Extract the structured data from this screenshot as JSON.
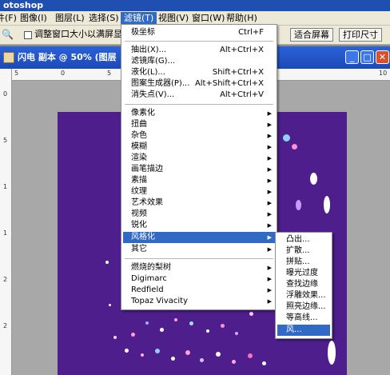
{
  "app": {
    "title": "otoshop"
  },
  "menubar": {
    "items": [
      {
        "label": "文件(F)"
      },
      {
        "label": "图像(I)"
      },
      {
        "label": "图层(L)"
      },
      {
        "label": "选择(S)"
      },
      {
        "label": "滤镜(T)"
      },
      {
        "label": "视图(V)"
      },
      {
        "label": "窗口(W)"
      },
      {
        "label": "帮助(H)"
      }
    ]
  },
  "options": {
    "resize_windows_label": "调整窗口大小以满屏显示",
    "fit_screen_label": "适合屏幕",
    "print_size_label": "打印尺寸"
  },
  "document": {
    "title": "闪电 副本 @ 50% (图层"
  },
  "ruler": {
    "top_labels": [
      "5",
      "0",
      "5",
      "10"
    ],
    "left_labels": [
      "0",
      "5",
      "1",
      "1",
      "2",
      "2"
    ]
  },
  "filter_menu": {
    "items": [
      {
        "label": "极坐标",
        "shortcut": "Ctrl+F"
      },
      {
        "label": "抽出(X)...",
        "shortcut": "Alt+Ctrl+X"
      },
      {
        "label": "滤镜库(G)...",
        "shortcut": ""
      },
      {
        "label": "液化(L)...",
        "shortcut": "Shift+Ctrl+X"
      },
      {
        "label": "图案生成器(P)...",
        "shortcut": "Alt+Shift+Ctrl+X"
      },
      {
        "label": "消失点(V)...",
        "shortcut": "Alt+Ctrl+V"
      },
      {
        "label": "像素化"
      },
      {
        "label": "扭曲"
      },
      {
        "label": "杂色"
      },
      {
        "label": "模糊"
      },
      {
        "label": "渲染"
      },
      {
        "label": "画笔描边"
      },
      {
        "label": "素描"
      },
      {
        "label": "纹理"
      },
      {
        "label": "艺术效果"
      },
      {
        "label": "视频"
      },
      {
        "label": "锐化"
      },
      {
        "label": "风格化"
      },
      {
        "label": "其它"
      },
      {
        "label": "燃烧的梨树"
      },
      {
        "label": "Digimarc"
      },
      {
        "label": "Redfield"
      },
      {
        "label": "Topaz Vivacity"
      }
    ]
  },
  "stylize_submenu": {
    "items": [
      {
        "label": "凸出..."
      },
      {
        "label": "扩散..."
      },
      {
        "label": "拼贴..."
      },
      {
        "label": "曝光过度"
      },
      {
        "label": "查找边缘"
      },
      {
        "label": "浮雕效果..."
      },
      {
        "label": "照亮边缘..."
      },
      {
        "label": "等高线..."
      },
      {
        "label": "风..."
      }
    ]
  },
  "colors": {
    "menu_highlight": "#316ac5",
    "canvas": "#4d1e8c",
    "title_bar": "#1f4fb0"
  }
}
